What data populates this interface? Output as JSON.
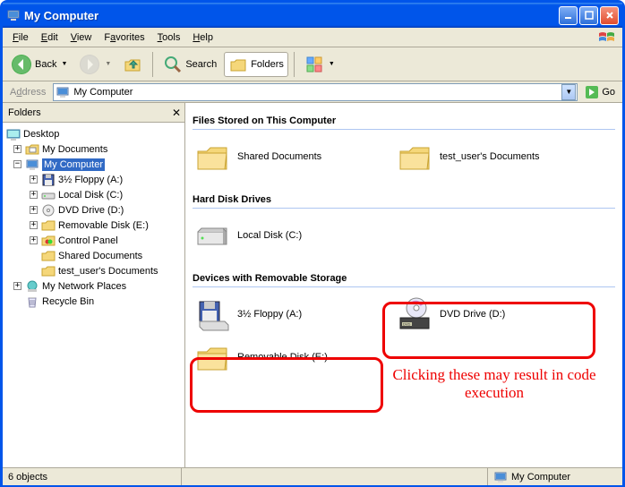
{
  "window": {
    "title": "My Computer"
  },
  "menu": {
    "file": "File",
    "edit": "Edit",
    "view": "View",
    "favorites": "Favorites",
    "tools": "Tools",
    "help": "Help"
  },
  "toolbar": {
    "back": "Back",
    "search": "Search",
    "folders": "Folders"
  },
  "addressbar": {
    "label": "Address",
    "value": "My Computer",
    "go": "Go"
  },
  "folders_panel": {
    "title": "Folders"
  },
  "tree": {
    "desktop": "Desktop",
    "my_documents": "My Documents",
    "my_computer": "My Computer",
    "floppy": "3½ Floppy (A:)",
    "local_disk": "Local Disk (C:)",
    "dvd": "DVD Drive (D:)",
    "removable": "Removable Disk (E:)",
    "control_panel": "Control Panel",
    "shared_docs": "Shared Documents",
    "user_docs": "test_user's Documents",
    "network": "My Network Places",
    "recycle": "Recycle Bin"
  },
  "sections": {
    "files_stored": "Files Stored on This Computer",
    "hard_disk": "Hard Disk Drives",
    "removable": "Devices with Removable Storage"
  },
  "items": {
    "shared_docs": "Shared Documents",
    "user_docs": "test_user's Documents",
    "local_disk": "Local Disk (C:)",
    "floppy": "3½ Floppy (A:)",
    "dvd": "DVD Drive (D:)",
    "removable": "Removable Disk (E:)"
  },
  "annotation": {
    "text": "Clicking these may result in code execution"
  },
  "statusbar": {
    "count": "6 objects",
    "location": "My Computer"
  }
}
